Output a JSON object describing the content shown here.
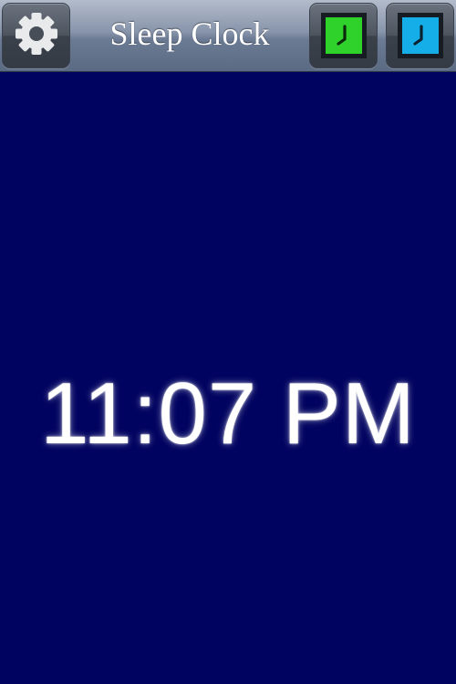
{
  "header": {
    "title": "Sleep Clock",
    "settings_icon": "gear-icon",
    "theme_buttons": [
      {
        "name": "green",
        "icon": "clock-icon",
        "color": "#2ed22b"
      },
      {
        "name": "blue",
        "icon": "clock-icon",
        "color": "#16aee9"
      }
    ]
  },
  "clock": {
    "time": "11:07 PM",
    "background_color": "#010360",
    "text_color": "#ffffff"
  }
}
